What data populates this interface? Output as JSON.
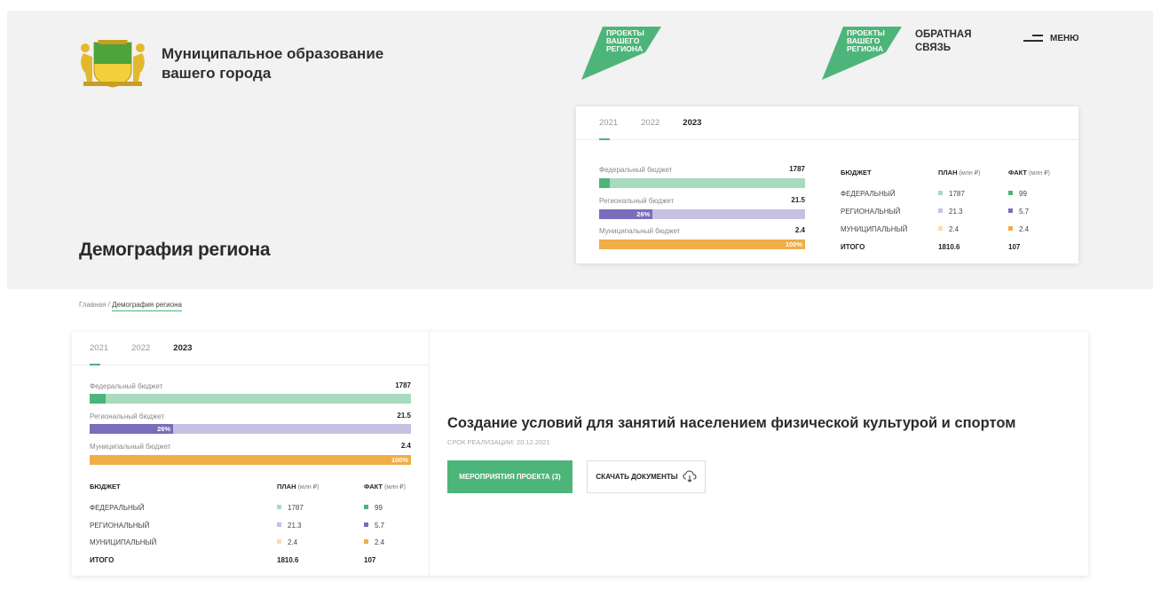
{
  "header": {
    "municipality_line1": "Муниципальное образование",
    "municipality_line2": "вашего города",
    "promo1": "ПРОЕКТЫ ВАШЕГО РЕГИОНА",
    "promo2": "ПРОЕКТЫ ВАШЕГО РЕГИОНА",
    "feedback_line1": "ОБРАТНАЯ",
    "feedback_line2": "СВЯЗЬ",
    "menu_label": "МЕНЮ"
  },
  "page_title": "Демография региона",
  "breadcrumb": {
    "home": "Главная",
    "separator": " / ",
    "current": "Демография региона"
  },
  "budget": {
    "years": [
      "2021",
      "2022",
      "2023"
    ],
    "active_year": "2023",
    "bars": [
      {
        "label": "Федеральный бюджет",
        "value": "1787",
        "fill_fraction": 0.05,
        "pct_label": "",
        "track_color": "#a8dbbd",
        "fill_color": "#4db57a"
      },
      {
        "label": "Региональный бюджет",
        "value": "21.5",
        "fill_fraction": 0.26,
        "pct_label": "26%",
        "track_color": "#c6c0e2",
        "fill_color": "#7b6cbc"
      },
      {
        "label": "Муниципальный бюджет",
        "value": "2.4",
        "fill_fraction": 1.0,
        "pct_label": "100%",
        "track_color": "#f2c585",
        "fill_color": "#f0ad48"
      }
    ],
    "table": {
      "col_budget": "БЮДЖЕТ",
      "col_plan": "ПЛАН",
      "col_plan_unit": "(млн ₽)",
      "col_fact": "ФАКТ",
      "col_fact_unit": "(млн ₽)",
      "rows": [
        {
          "name": "ФЕДЕРАЛЬНЫЙ",
          "plan": "1787",
          "fact": "99",
          "plan_color": "#a8dbbd",
          "fact_color": "#4db57a"
        },
        {
          "name": "РЕГИОНАЛЬНЫЙ",
          "plan": "21.3",
          "fact": "5.7",
          "plan_color": "#c6c0e2",
          "fact_color": "#7b6cbc"
        },
        {
          "name": "МУНИЦИПАЛЬНЫЙ",
          "plan": "2.4",
          "fact": "2.4",
          "plan_color": "#f9dcae",
          "fact_color": "#f0ad48"
        }
      ],
      "total": {
        "name": "ИТОГО",
        "plan": "1810.6",
        "fact": "107"
      }
    }
  },
  "project": {
    "title": "Создание условий для занятий населением физической культурой и спортом",
    "date": "СРОК РЕАЛИЗАЦИИ: 20.12.2021",
    "events_button": "МЕРОПРИЯТИЯ ПРОЕКТА (3)",
    "download_button": "СКАЧАТЬ ДОКУМЕНТЫ",
    "download_icon": "cloud-download-icon"
  },
  "colors": {
    "accent_green": "#4db57a",
    "hero_bg": "#f2f2f2"
  }
}
